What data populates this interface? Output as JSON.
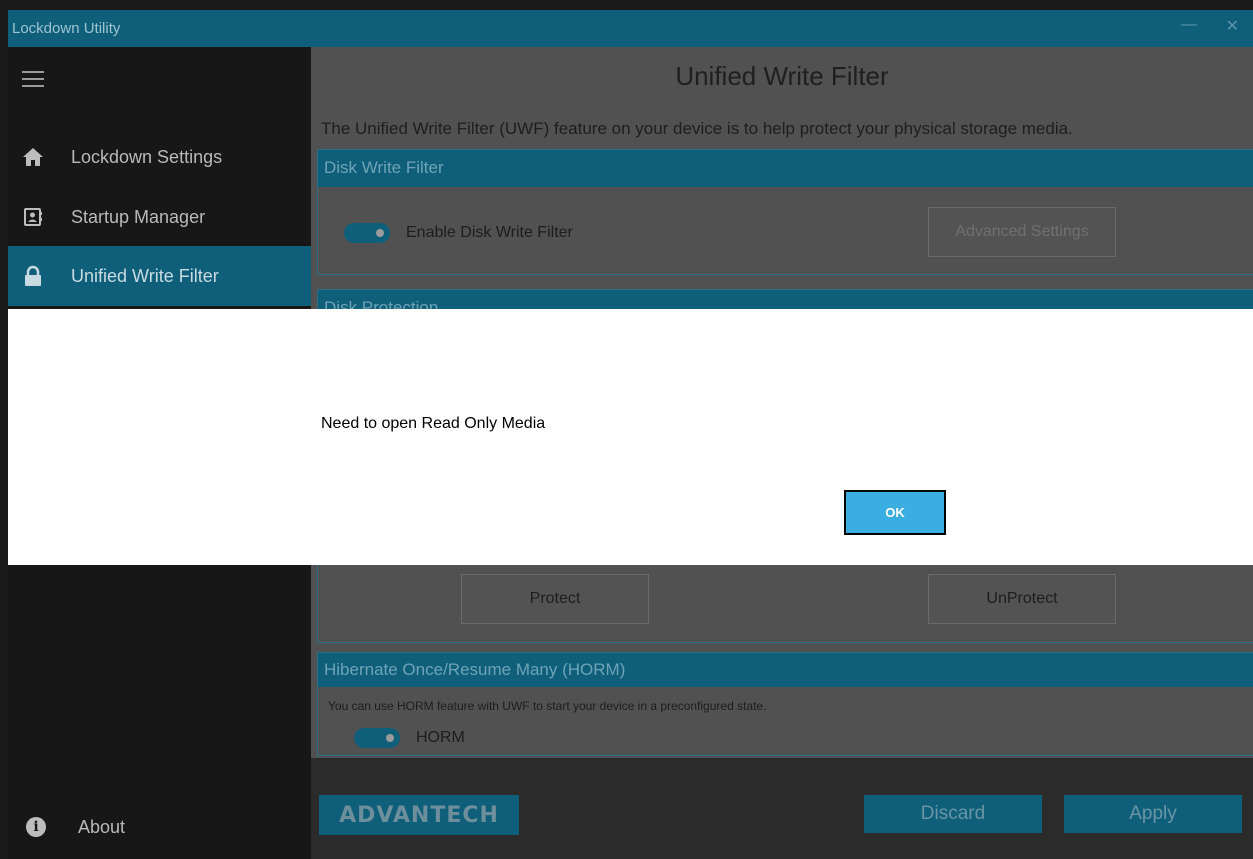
{
  "window": {
    "title": "Lockdown Utility",
    "minimize_glyph": "—",
    "close_glyph": "✕"
  },
  "sidebar": {
    "menu_icon": "hamburger-icon",
    "items": [
      {
        "label": "Lockdown Settings",
        "icon": "home-icon"
      },
      {
        "label": "Startup Manager",
        "icon": "contact-card-icon"
      },
      {
        "label": "Unified Write Filter",
        "icon": "lock-icon",
        "active": true
      }
    ],
    "about": {
      "label": "About",
      "icon": "info-icon"
    }
  },
  "main": {
    "title": "Unified Write Filter",
    "description": "The Unified Write Filter (UWF) feature on your device is to help protect your physical storage media.",
    "disk_write_filter": {
      "header": "Disk Write Filter",
      "toggle_label": "Enable Disk Write Filter",
      "toggle_on": true,
      "advanced_button": "Advanced Settings"
    },
    "disk_protection": {
      "header": "Disk Protection",
      "protect_button": "Protect",
      "unprotect_button": "UnProtect"
    },
    "horm": {
      "header": "Hibernate Once/Resume Many (HORM)",
      "description": "You can use HORM feature with UWF to start your device in a preconfigured state.",
      "toggle_label": "HORM",
      "toggle_on": true
    },
    "footer": {
      "logo_text": "ADVANTECH",
      "discard_button": "Discard",
      "apply_button": "Apply"
    }
  },
  "dialog": {
    "message": "Need to open Read Only Media",
    "ok_button": "OK"
  },
  "colors": {
    "accent": "#0f5f7a",
    "dialog_button": "#3aaee0"
  }
}
